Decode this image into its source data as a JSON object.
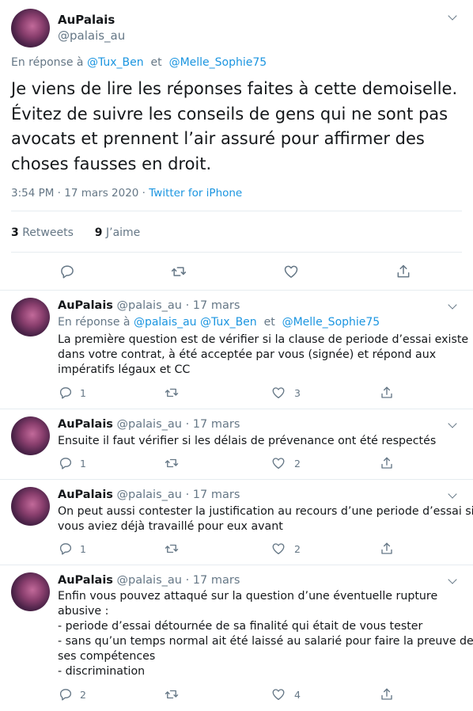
{
  "main_tweet": {
    "author_name": "AuPalais",
    "author_handle": "@palais_au",
    "reply_prefix": "En réponse à",
    "reply_to": [
      "@Tux_Ben",
      "@Melle_Sophie75"
    ],
    "reply_joiner": "et",
    "text_lines": [
      "Je viens de lire les réponses faites à cette demoiselle.",
      "Évitez de suivre les conseils de gens qui ne sont pas",
      "avocats et prennent l’air assuré pour affirmer des",
      "choses fausses en droit."
    ],
    "time": "3:54 PM · 17 mars 2020 ·",
    "source": "Twitter for iPhone",
    "retweets_count": "3",
    "retweets_label": "Retweets",
    "likes_count": "9",
    "likes_label": "J’aime"
  },
  "replies": [
    {
      "name": "AuPalais",
      "handle": "@palais_au",
      "date": "· 17 mars",
      "reply_prefix": "En réponse à",
      "reply_to": [
        "@palais_au",
        "@Tux_Ben",
        "@Melle_Sophie75"
      ],
      "reply_joiner": "et",
      "lines": [
        "La première question est de vérifier si la clause de periode d’essai existe",
        "dans votre contrat, à été acceptée par vous (signée) et répond aux",
        "impératifs légaux et CC"
      ],
      "reply_count": "1",
      "retweet_count": "",
      "like_count": "3"
    },
    {
      "name": "AuPalais",
      "handle": "@palais_au",
      "date": "· 17 mars",
      "lines": [
        "Ensuite il faut vérifier si les délais de prévenance ont été respectés"
      ],
      "reply_count": "1",
      "retweet_count": "",
      "like_count": "2"
    },
    {
      "name": "AuPalais",
      "handle": "@palais_au",
      "date": "· 17 mars",
      "lines": [
        "On peut aussi contester la justification au recours d’une periode d’essai si",
        "vous aviez déjà travaillé pour eux avant"
      ],
      "reply_count": "1",
      "retweet_count": "",
      "like_count": "2"
    },
    {
      "name": "AuPalais",
      "handle": "@palais_au",
      "date": "· 17 mars",
      "lines": [
        "Enfin vous pouvez attaqué sur la question d’une éventuelle rupture",
        "abusive :",
        "- periode d’essai détournée de sa finalité qui était de vous tester",
        "- sans qu’un temps normal ait été laissé au salarié pour faire la preuve de",
        "ses compétences",
        "- discrimination"
      ],
      "reply_count": "2",
      "retweet_count": "",
      "like_count": "4"
    }
  ],
  "icons": {
    "reply": "reply-icon",
    "retweet": "retweet-icon",
    "like": "heart-icon",
    "share": "share-icon",
    "more": "chevron-down-icon"
  },
  "colors": {
    "link": "#1b95e0",
    "secondary_text": "#657786",
    "border": "#e6ecf0"
  }
}
